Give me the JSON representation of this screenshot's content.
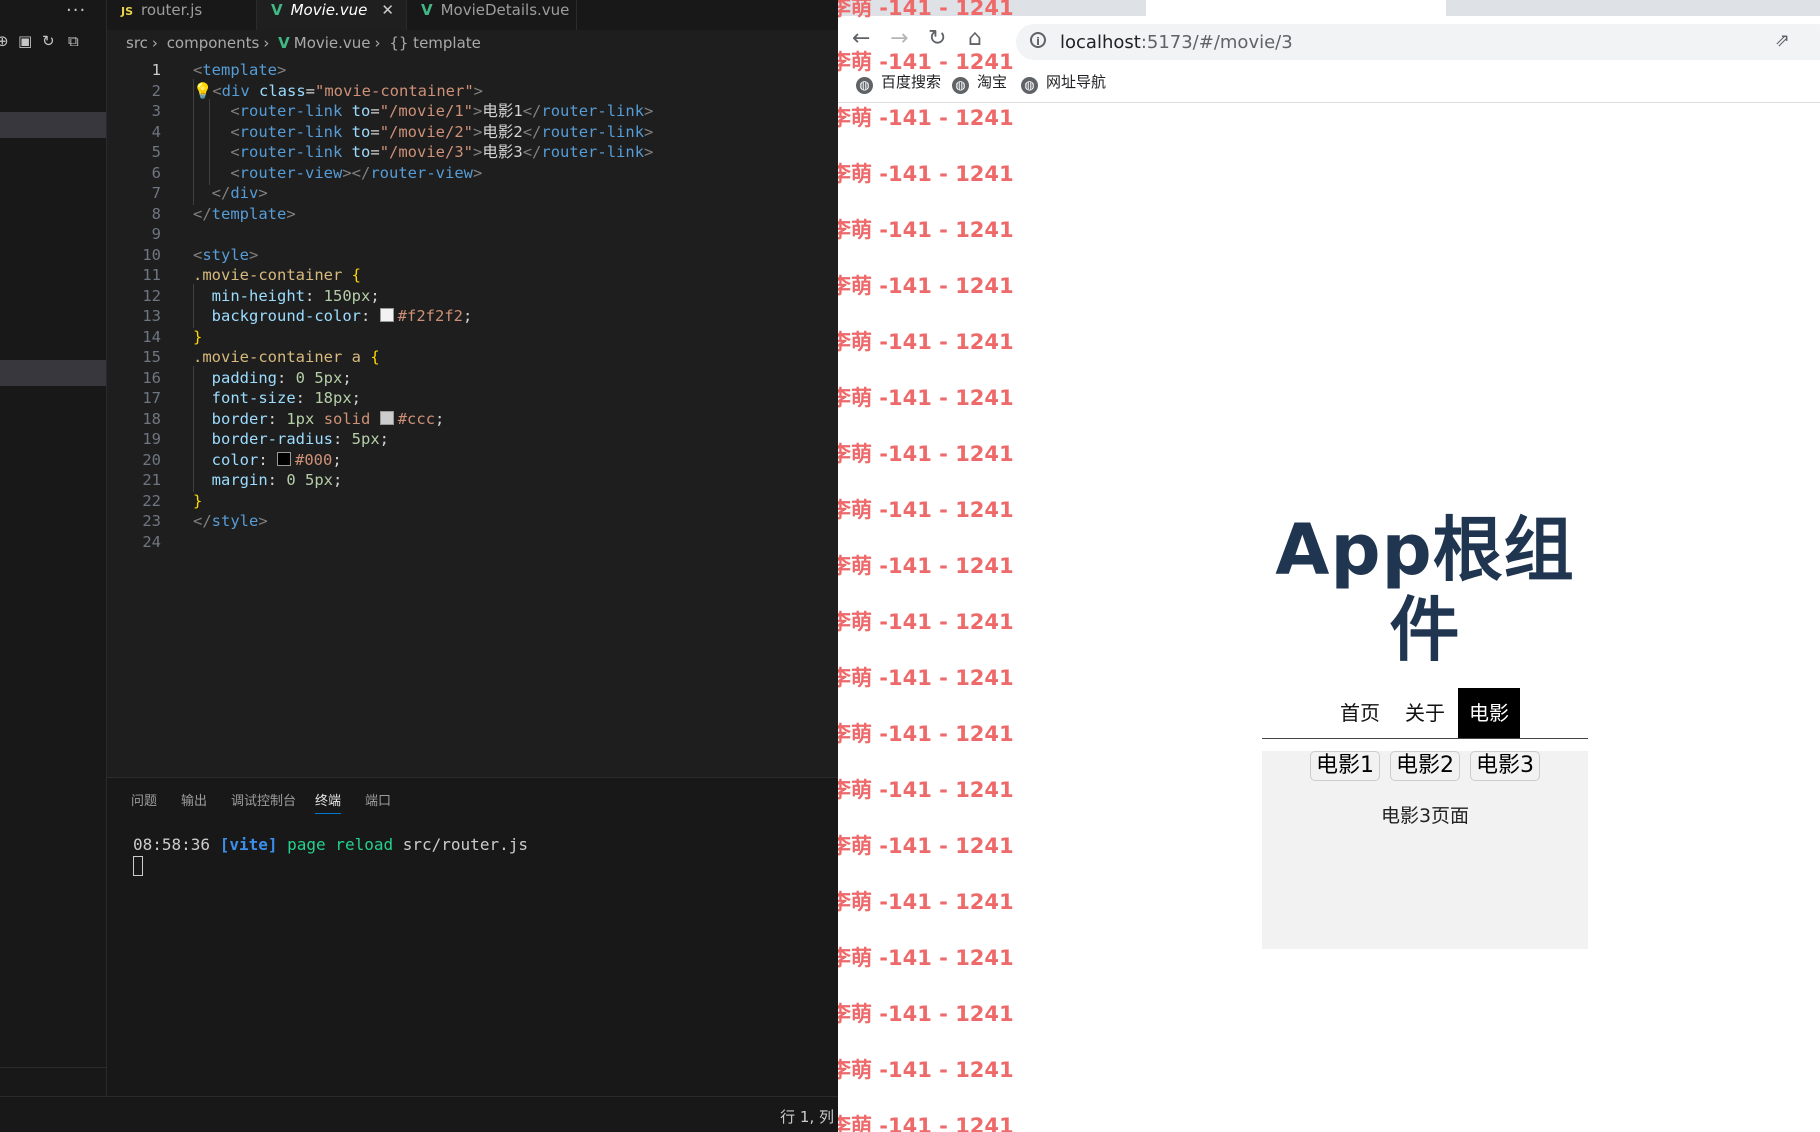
{
  "editor": {
    "tabs": [
      {
        "label": "router.js",
        "icon": "JS"
      },
      {
        "label": "Movie.vue",
        "icon": "V",
        "close": "✕"
      },
      {
        "label": "MovieDetails.vue",
        "icon": "V"
      }
    ],
    "breadcrumb": [
      "src",
      "components",
      "Movie.vue",
      "{} template"
    ],
    "panel_tabs": [
      "问题",
      "输出",
      "调试控制台",
      "终端",
      "端口"
    ],
    "active_panel_tab": "终端",
    "terminal": {
      "time": "08:58:36",
      "tool": "[vite]",
      "msg": "page reload",
      "file": "src/router.js"
    },
    "status": "行 1, 列"
  },
  "browser": {
    "url_host": "localhost",
    "url_path": ":5173/#/movie/3",
    "bookmarks": [
      "百度搜索",
      "淘宝",
      "网址导航"
    ],
    "watermark": "李萌 -141 - 1241",
    "app": {
      "title": "App根组件",
      "nav": [
        "首页",
        "关于",
        "电影"
      ],
      "active_nav": "电影",
      "movie_links": [
        "电影1",
        "电影2",
        "电影3"
      ],
      "page_text": "电影3页面"
    }
  },
  "colors": {
    "editor_bg": "#1e1e1e",
    "watermark": "#ee6a6a",
    "title": "#1f3550",
    "nav_active_bg": "#000000",
    "movie_box_bg": "#f2f2f2"
  }
}
